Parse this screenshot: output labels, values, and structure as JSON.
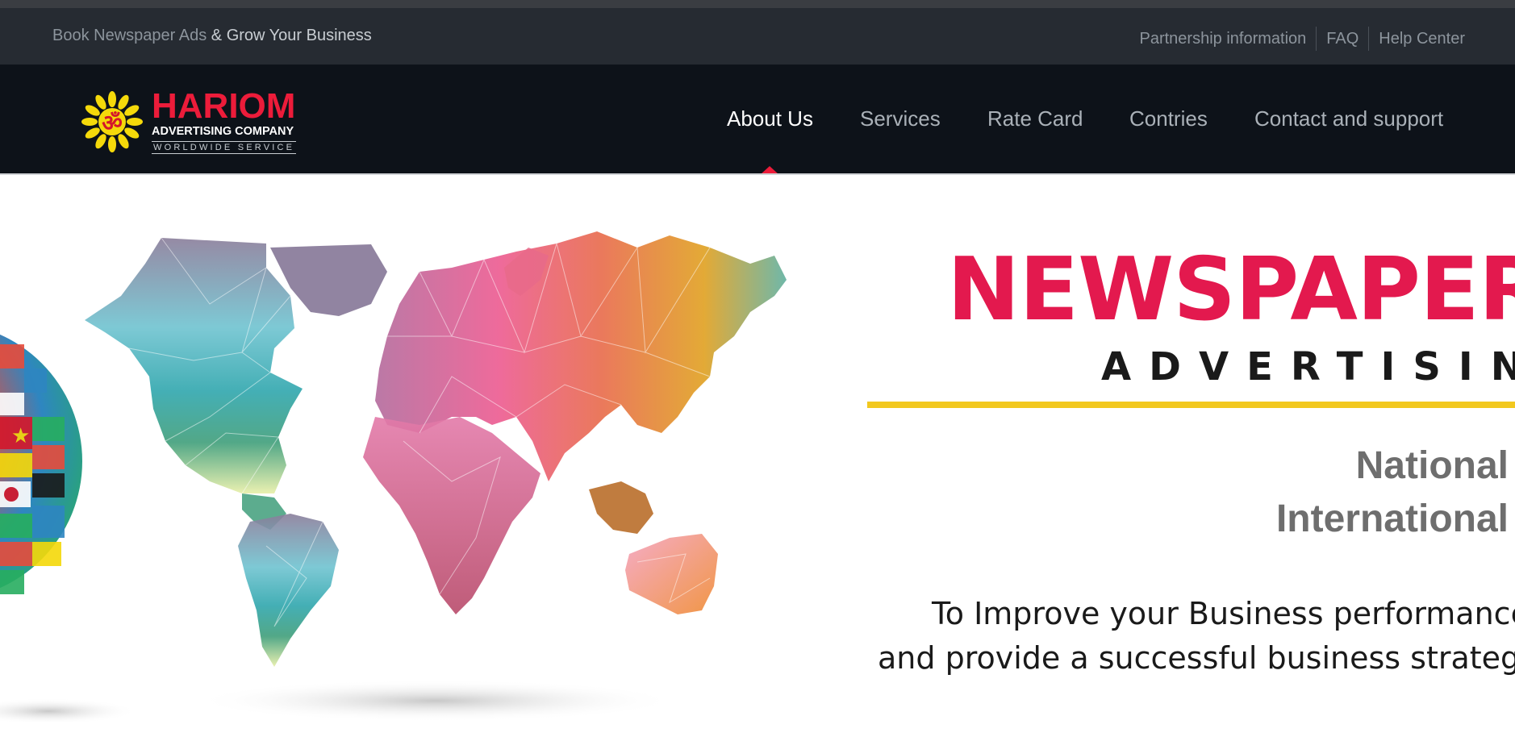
{
  "topbar": {
    "tagline_part1": "Book Newspaper Ads",
    "tagline_amp": " & ",
    "tagline_part2": "Grow Your Business",
    "links": [
      "Partnership information",
      "FAQ",
      "Help Center"
    ]
  },
  "logo": {
    "name": "HARIOM",
    "subtitle": "ADVERTISING COMPANY",
    "tagline": "WORLDWIDE SERVICE",
    "symbol": "ॐ"
  },
  "nav": {
    "items": [
      "About Us",
      "Services",
      "Rate Card",
      "Contries",
      "Contact and support"
    ],
    "active": "About Us"
  },
  "hero": {
    "headline": "NEWSPAPER",
    "subhead": "ADVERTISING",
    "line1": "National",
    "line2": "International",
    "body1": "To Improve your Business performance",
    "body2": "and provide a successful business strategy"
  },
  "colors": {
    "brand_red": "#ec1c3a",
    "headline_pink": "#e3194e",
    "accent_yellow": "#f2c81f",
    "nav_bg": "#0d1219",
    "topbar_bg": "#262b32"
  }
}
